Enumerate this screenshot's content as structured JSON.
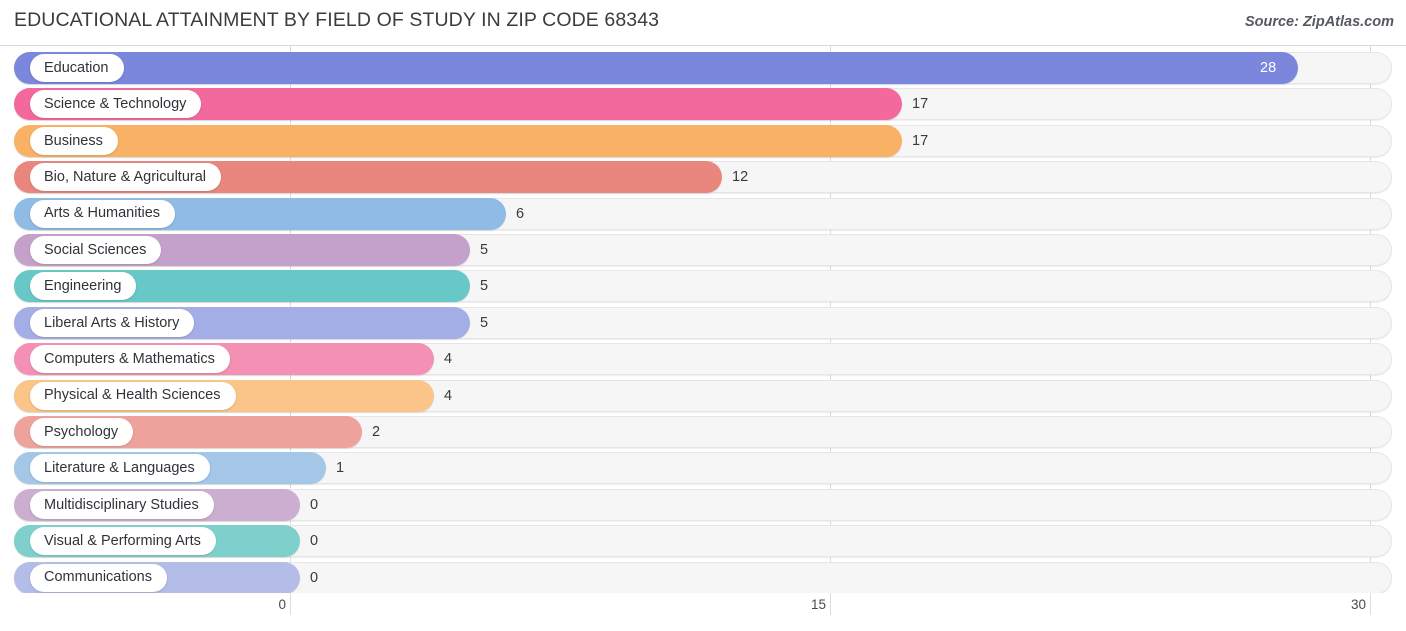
{
  "header": {
    "title": "EDUCATIONAL ATTAINMENT BY FIELD OF STUDY IN ZIP CODE 68343",
    "source": "Source: ZipAtlas.com"
  },
  "chart_data": {
    "type": "bar",
    "orientation": "horizontal",
    "title": "EDUCATIONAL ATTAINMENT BY FIELD OF STUDY IN ZIP CODE 68343",
    "xlabel": "",
    "ylabel": "",
    "xlim": [
      0,
      30
    ],
    "xticks": [
      "0",
      "15",
      "30"
    ],
    "xtick_values": [
      0,
      15,
      30
    ],
    "grid": true,
    "legend": "none",
    "categories": [
      "Education",
      "Science & Technology",
      "Business",
      "Bio, Nature & Agricultural",
      "Arts & Humanities",
      "Social Sciences",
      "Engineering",
      "Liberal Arts & History",
      "Computers & Mathematics",
      "Physical & Health Sciences",
      "Psychology",
      "Literature & Languages",
      "Multidisciplinary Studies",
      "Visual & Performing Arts",
      "Communications"
    ],
    "values": [
      28,
      17,
      17,
      12,
      6,
      5,
      5,
      5,
      4,
      4,
      2,
      1,
      0,
      0,
      0
    ],
    "value_labels": [
      "28",
      "17",
      "17",
      "12",
      "6",
      "5",
      "5",
      "5",
      "4",
      "4",
      "2",
      "1",
      "0",
      "0",
      "0"
    ],
    "colors": [
      "#7b87dd",
      "#f4699d",
      "#f9b166",
      "#e9877f",
      "#8fbbe4",
      "#c3a1ca",
      "#68c8c8",
      "#a4aee6",
      "#f490b4",
      "#fbc489",
      "#eda39c",
      "#a4c7e8",
      "#cbaed0",
      "#7fd0cd",
      "#b4bce8"
    ]
  }
}
